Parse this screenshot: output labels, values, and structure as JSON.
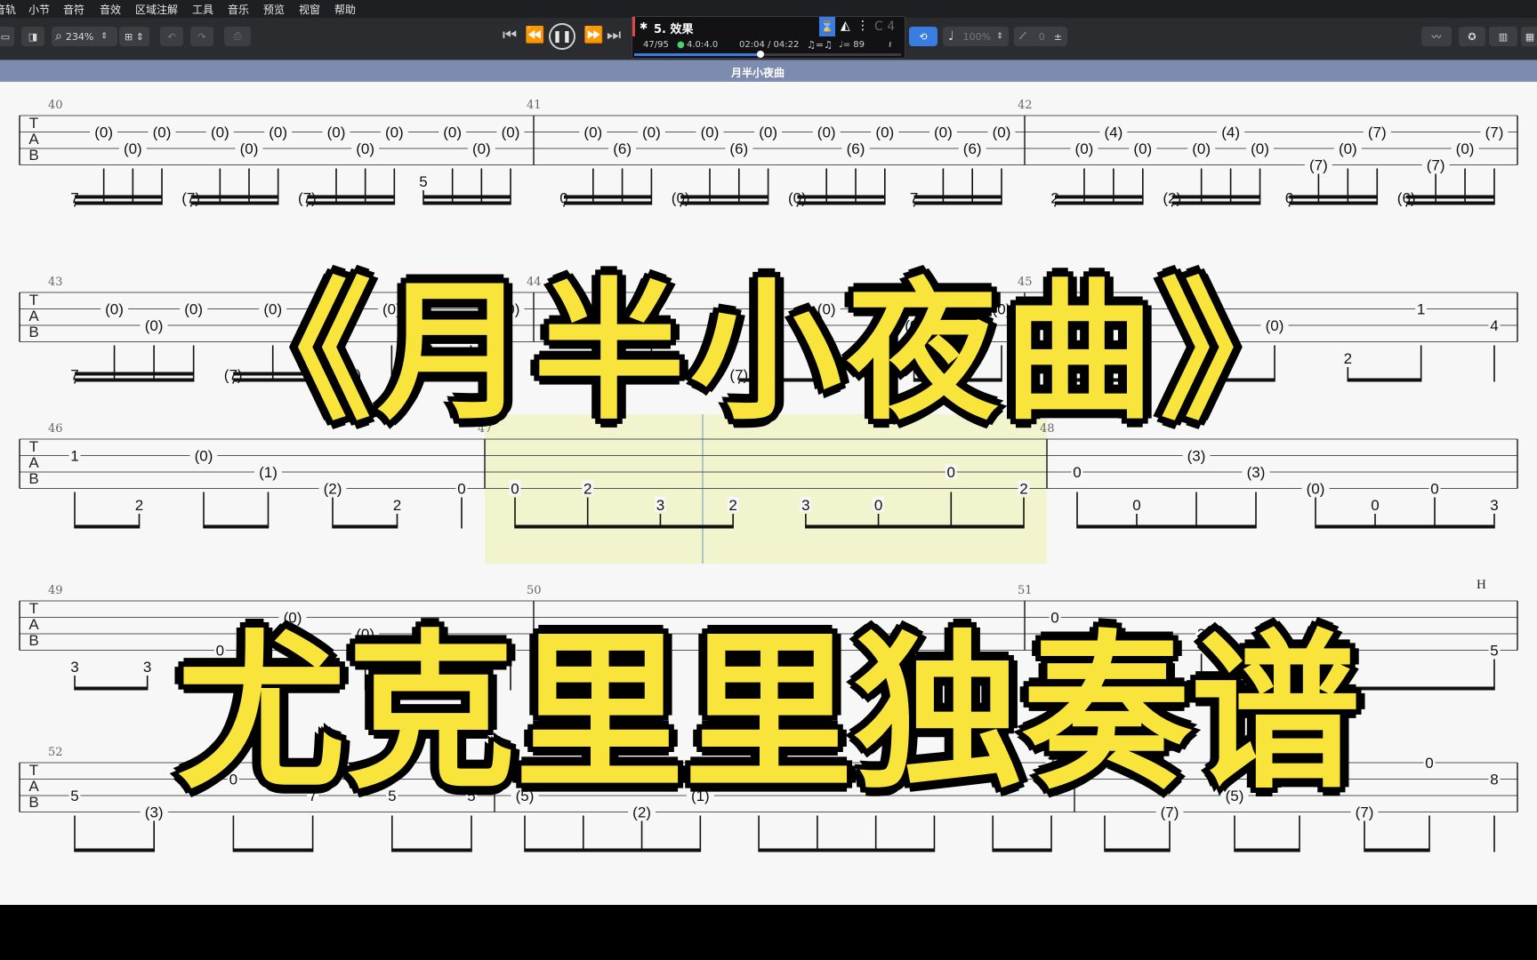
{
  "menu": [
    "音轨",
    "小节",
    "音符",
    "音效",
    "区域注解",
    "工具",
    "音乐",
    "预览",
    "视窗",
    "帮助"
  ],
  "toolbar": {
    "zoom": "234%",
    "track_name": "5. 效果",
    "bar_position": "47/95",
    "time_signature": "4.0:4.0",
    "time": "02:04 / 04:22",
    "swing": "♫=♫",
    "tempo": "♩= 89",
    "key": "C 4",
    "volume": "100%",
    "pitch": "0",
    "progress": 0.473,
    "accent_color": "#3a7de0"
  },
  "score": {
    "title": "月半小夜曲",
    "systems": [
      {
        "id": "sys-1",
        "bars": [
          {
            "number": "40",
            "notes": [
              {
                "s": 6,
                "t": "7"
              },
              {
                "s": 2,
                "t": "(0)"
              },
              {
                "s": 3,
                "t": "(0)"
              },
              {
                "s": 2,
                "t": "(0)"
              },
              {
                "s": 6,
                "t": "(7)"
              },
              {
                "s": 2,
                "t": "(0)"
              },
              {
                "s": 3,
                "t": "(0)"
              },
              {
                "s": 2,
                "t": "(0)"
              },
              {
                "s": 6,
                "t": "(7)"
              },
              {
                "s": 2,
                "t": "(0)"
              },
              {
                "s": 3,
                "t": "(0)"
              },
              {
                "s": 2,
                "t": "(0)"
              },
              {
                "s": 5,
                "t": "5"
              },
              {
                "s": 2,
                "t": "(0)"
              },
              {
                "s": 3,
                "t": "(0)"
              },
              {
                "s": 2,
                "t": "(0)"
              }
            ]
          },
          {
            "number": "41",
            "notes": [
              {
                "s": 6,
                "t": "0"
              },
              {
                "s": 2,
                "t": "(0)"
              },
              {
                "s": 3,
                "t": "(6)"
              },
              {
                "s": 2,
                "t": "(0)"
              },
              {
                "s": 6,
                "t": "(0)"
              },
              {
                "s": 2,
                "t": "(0)"
              },
              {
                "s": 3,
                "t": "(6)"
              },
              {
                "s": 2,
                "t": "(0)"
              },
              {
                "s": 6,
                "t": "(0)"
              },
              {
                "s": 2,
                "t": "(0)"
              },
              {
                "s": 3,
                "t": "(6)"
              },
              {
                "s": 2,
                "t": "(0)"
              },
              {
                "s": 6,
                "t": "7"
              },
              {
                "s": 2,
                "t": "(0)"
              },
              {
                "s": 3,
                "t": "(6)"
              },
              {
                "s": 2,
                "t": "(0)"
              }
            ]
          },
          {
            "number": "42",
            "notes": [
              {
                "s": 6,
                "t": "2"
              },
              {
                "s": 3,
                "t": "(0)"
              },
              {
                "s": 2,
                "t": "(4)"
              },
              {
                "s": 3,
                "t": "(0)"
              },
              {
                "s": 6,
                "t": "(2)"
              },
              {
                "s": 3,
                "t": "(0)"
              },
              {
                "s": 2,
                "t": "(4)"
              },
              {
                "s": 3,
                "t": "(0)"
              },
              {
                "s": 6,
                "t": "6"
              },
              {
                "s": 4,
                "t": "(7)"
              },
              {
                "s": 3,
                "t": "(0)"
              },
              {
                "s": 2,
                "t": "(7)"
              },
              {
                "s": 6,
                "t": "(6)"
              },
              {
                "s": 4,
                "t": "(7)"
              },
              {
                "s": 3,
                "t": "(0)"
              },
              {
                "s": 2,
                "t": "(7)"
              }
            ]
          }
        ]
      },
      {
        "id": "sys-2",
        "bars": [
          {
            "number": "43",
            "notes": [
              {
                "s": 6,
                "t": "7"
              },
              {
                "s": 2,
                "t": "(0)"
              },
              {
                "s": 3,
                "t": "(0)"
              },
              {
                "s": 2,
                "t": "(0)"
              },
              {
                "s": 6,
                "t": "(7)"
              },
              {
                "s": 2,
                "t": "(0)"
              },
              {
                "s": 3,
                "t": "(0)"
              },
              {
                "s": 6,
                "t": "(7)"
              },
              {
                "s": 2,
                "t": "(0)"
              },
              {
                "s": 3,
                "t": "(0)"
              },
              {
                "s": 3,
                "t": "(0)"
              },
              {
                "s": 2,
                "t": "(0)"
              }
            ]
          },
          {
            "number": "44",
            "notes": [
              {
                "s": 6,
                "t": "(7)"
              },
              {
                "s": 2,
                "t": "(0)"
              },
              {
                "s": 6,
                "t": "(7)"
              },
              {
                "s": 2,
                "t": "(0)"
              },
              {
                "s": 3,
                "t": "(0)"
              },
              {
                "s": 2,
                "t": "(0)"
              }
            ]
          },
          {
            "number": "45",
            "notes": [
              {
                "s": 6,
                "t": "(2)"
              },
              {
                "s": 3,
                "t": "(0)"
              },
              {
                "s": 2,
                "t": "(4)"
              },
              {
                "s": 3,
                "t": "(0)"
              },
              {
                "s": 5,
                "t": "2"
              },
              {
                "s": 2,
                "t": "1"
              },
              {
                "s": 3,
                "t": "4"
              }
            ]
          }
        ]
      },
      {
        "id": "sys-3",
        "bars": [
          {
            "number": "46",
            "notes": [
              {
                "s": 2,
                "t": "1"
              },
              {
                "s": 5,
                "t": "2"
              },
              {
                "s": 2,
                "t": "(0)"
              },
              {
                "s": 3,
                "t": "(1)"
              },
              {
                "s": 4,
                "t": "(2)"
              },
              {
                "s": 5,
                "t": "2"
              },
              {
                "s": 4,
                "t": "0"
              }
            ]
          },
          {
            "number": "47",
            "notes": [
              {
                "s": 4,
                "t": "0"
              },
              {
                "s": 4,
                "t": "2"
              },
              {
                "s": 5,
                "t": "3"
              },
              {
                "s": 5,
                "t": "2"
              },
              {
                "s": 5,
                "t": "3"
              },
              {
                "s": 5,
                "t": "0"
              },
              {
                "s": 3,
                "t": "0"
              },
              {
                "s": 4,
                "t": "2"
              }
            ]
          },
          {
            "number": "48",
            "notes": [
              {
                "s": 3,
                "t": "0"
              },
              {
                "s": 5,
                "t": "0"
              },
              {
                "s": 2,
                "t": "(3)"
              },
              {
                "s": 3,
                "t": "(3)"
              },
              {
                "s": 4,
                "t": "(0)"
              },
              {
                "s": 5,
                "t": "0"
              },
              {
                "s": 4,
                "t": "0"
              },
              {
                "s": 5,
                "t": "3"
              }
            ]
          }
        ]
      },
      {
        "id": "sys-4",
        "bars": [
          {
            "number": "49",
            "notes": [
              {
                "s": 5,
                "t": "3"
              },
              {
                "s": 5,
                "t": "3"
              },
              {
                "s": 4,
                "t": "0"
              },
              {
                "s": 2,
                "t": "(0)"
              },
              {
                "s": 3,
                "t": "(0)"
              },
              {
                "s": 4,
                "t": "(1)"
              },
              {
                "s": 4,
                "t": "4"
              }
            ]
          },
          {
            "number": "50",
            "notes": [
              {
                "s": 5,
                "t": "2"
              }
            ]
          },
          {
            "number": "51",
            "notes": [
              {
                "s": 2,
                "t": "0"
              },
              {
                "s": 3,
                "t": "3"
              },
              {
                "s": 4,
                "t": "2"
              },
              {
                "s": 4,
                "t": "5"
              }
            ],
            "annotation": "H"
          }
        ]
      },
      {
        "id": "sys-5",
        "bars": [
          {
            "number": "52",
            "notes": [
              {
                "s": 3,
                "t": "5"
              },
              {
                "s": 4,
                "t": "(3)"
              },
              {
                "s": 2,
                "t": "0"
              },
              {
                "s": 3,
                "t": "7"
              },
              {
                "s": 3,
                "t": "5"
              },
              {
                "s": 3,
                "t": "5"
              }
            ]
          },
          {
            "number": "53",
            "notes": [
              {
                "s": 3,
                "t": "(5)"
              },
              {
                "s": 2,
                "t": "0"
              },
              {
                "s": 4,
                "t": "(2)"
              },
              {
                "s": 3,
                "t": "(1)"
              },
              {
                "s": 2,
                "t": "(0)"
              },
              {
                "s": 1,
                "t": "(0)"
              },
              {
                "s": 2,
                "t": "5"
              },
              {
                "s": 2,
                "t": "5"
              },
              {
                "s": 1,
                "t": "8"
              },
              {
                "s": 1,
                "t": "7"
              }
            ]
          },
          {
            "number": "54",
            "notes": [
              {
                "s": 1,
                "t": "8"
              },
              {
                "s": 4,
                "t": "(7)"
              },
              {
                "s": 3,
                "t": "(5)"
              },
              {
                "s": 1,
                "t": "0"
              },
              {
                "s": 4,
                "t": "(7)"
              },
              {
                "s": 1,
                "t": "0"
              },
              {
                "s": 2,
                "t": "8"
              }
            ]
          }
        ]
      }
    ]
  },
  "overlay": {
    "title_line": "《月半小夜曲》",
    "subtitle_line": "尤克里里独奏谱",
    "fill_color": "#f8e43a",
    "stroke_color": "#000000"
  },
  "tab_label": "TAB"
}
